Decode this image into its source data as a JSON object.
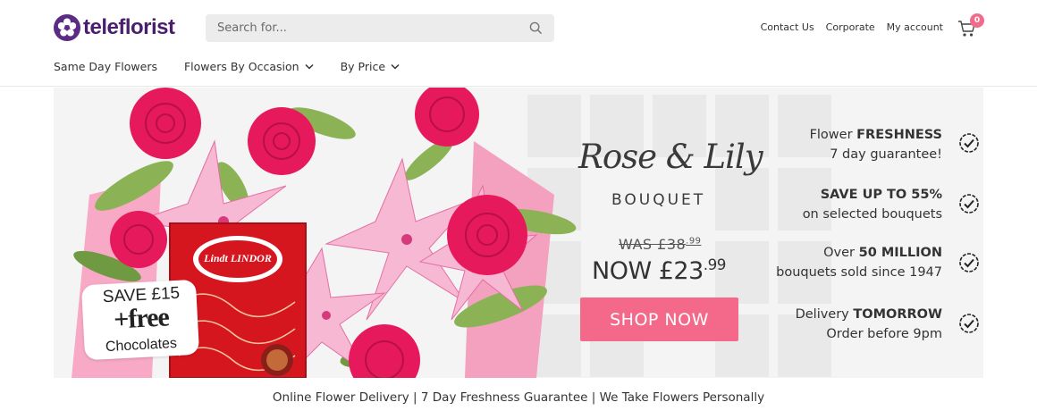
{
  "header": {
    "logo_text": "teleflorist",
    "search": {
      "placeholder": "Search for..."
    },
    "top_links": [
      "Contact Us",
      "Corporate",
      "My account"
    ],
    "cart": {
      "count": "0"
    }
  },
  "nav": {
    "items": [
      {
        "label": "Same Day Flowers",
        "has_dropdown": false
      },
      {
        "label": "Flowers By Occasion",
        "has_dropdown": true
      },
      {
        "label": "By Price",
        "has_dropdown": true
      }
    ]
  },
  "hero": {
    "promo": {
      "line1": "SAVE £15",
      "line2": "+free",
      "line3": "Chocolates"
    },
    "product_box_text": "Lindt LINDOR",
    "title_script": "Rose & Lily",
    "title_sub": "BOUQUET",
    "was_price": {
      "main": "WAS £38",
      "pence": ".99"
    },
    "now_price": {
      "main": "NOW £23",
      "pence": ".99"
    },
    "cta_label": "SHOP NOW",
    "usps": [
      {
        "line1_pre": "Flower ",
        "line1_bold": "FRESHNESS",
        "line1_post": "",
        "line2": "7 day guarantee!"
      },
      {
        "line1_pre": "",
        "line1_bold": "SAVE UP TO 55%",
        "line1_post": "",
        "line2": "on selected bouquets"
      },
      {
        "line1_pre": "Over ",
        "line1_bold": "50 MILLION",
        "line1_post": "",
        "line2": "bouquets sold since 1947"
      },
      {
        "line1_pre": "Delivery ",
        "line1_bold": "TOMORROW",
        "line1_post": "",
        "line2": "Order before 9pm"
      }
    ]
  },
  "tagline": "Online Flower Delivery | 7 Day Freshness Guarantee | We Take Flowers Personally",
  "colors": {
    "brand_purple": "#5b2c83",
    "cta_pink": "#f4698a",
    "badge_pink": "#f06c8d"
  }
}
